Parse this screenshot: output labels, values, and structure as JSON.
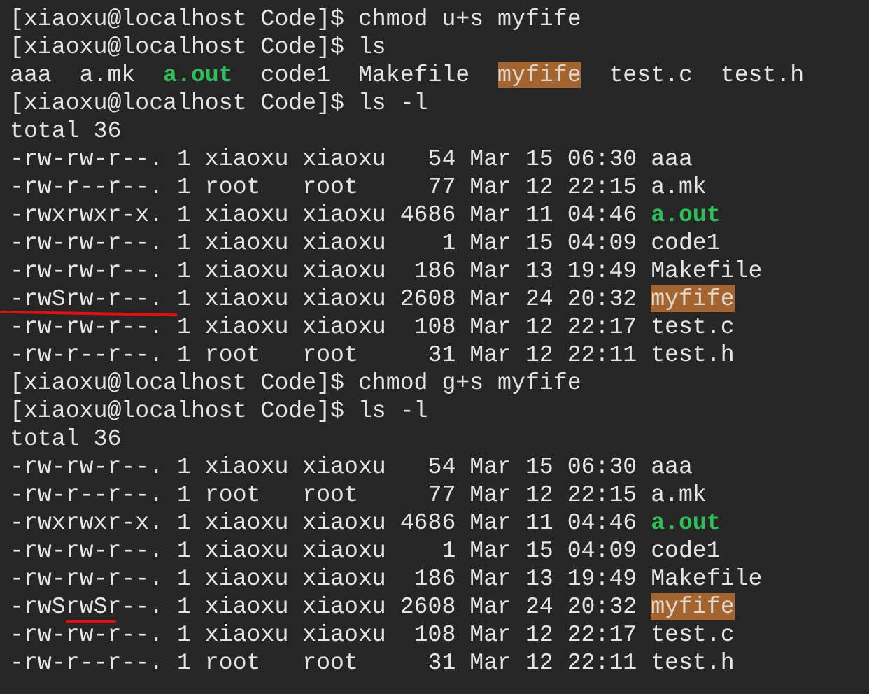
{
  "terminal": {
    "lines": [
      {
        "segments": [
          {
            "text": "[xiaoxu@localhost Code]$ chmod u+s myfife",
            "kind": "plain"
          }
        ]
      },
      {
        "segments": [
          {
            "text": "[xiaoxu@localhost Code]$ ls",
            "kind": "plain"
          }
        ]
      },
      {
        "segments": [
          {
            "text": "aaa  a.mk  ",
            "kind": "plain"
          },
          {
            "text": "a.out",
            "kind": "exec"
          },
          {
            "text": "  code1  Makefile  ",
            "kind": "plain"
          },
          {
            "text": "myfife",
            "kind": "setid"
          },
          {
            "text": "  test.c  test.h",
            "kind": "plain"
          }
        ]
      },
      {
        "segments": [
          {
            "text": "[xiaoxu@localhost Code]$ ls -l",
            "kind": "plain"
          }
        ]
      },
      {
        "segments": [
          {
            "text": "total 36",
            "kind": "plain"
          }
        ]
      },
      {
        "segments": [
          {
            "text": "-rw-rw-r--. 1 xiaoxu xiaoxu   54 Mar 15 06:30 ",
            "kind": "plain"
          },
          {
            "text": "aaa",
            "kind": "plain"
          }
        ]
      },
      {
        "segments": [
          {
            "text": "-rw-r--r--. 1 root   root     77 Mar 12 22:15 ",
            "kind": "plain"
          },
          {
            "text": "a.mk",
            "kind": "plain"
          }
        ]
      },
      {
        "segments": [
          {
            "text": "-rwxrwxr-x. 1 xiaoxu xiaoxu 4686 Mar 11 04:46 ",
            "kind": "plain"
          },
          {
            "text": "a.out",
            "kind": "exec"
          }
        ]
      },
      {
        "segments": [
          {
            "text": "-rw-rw-r--. 1 xiaoxu xiaoxu    1 Mar 15 04:09 ",
            "kind": "plain"
          },
          {
            "text": "code1",
            "kind": "plain"
          }
        ]
      },
      {
        "segments": [
          {
            "text": "-rw-rw-r--. 1 xiaoxu xiaoxu  186 Mar 13 19:49 ",
            "kind": "plain"
          },
          {
            "text": "Makefile",
            "kind": "plain"
          }
        ]
      },
      {
        "segments": [
          {
            "text": "-rwSrw-r--. 1 xiaoxu xiaoxu 2608 Mar 24 20:32 ",
            "kind": "plain"
          },
          {
            "text": "myfife",
            "kind": "setid"
          }
        ],
        "annotation": {
          "kind": "long-underline"
        }
      },
      {
        "segments": [
          {
            "text": "-rw-rw-r--. 1 xiaoxu xiaoxu  108 Mar 12 22:17 ",
            "kind": "plain"
          },
          {
            "text": "test.c",
            "kind": "plain"
          }
        ]
      },
      {
        "segments": [
          {
            "text": "-rw-r--r--. 1 root   root     31 Mar 12 22:11 ",
            "kind": "plain"
          },
          {
            "text": "test.h",
            "kind": "plain"
          }
        ]
      },
      {
        "segments": [
          {
            "text": "[xiaoxu@localhost Code]$ chmod g+s myfife",
            "kind": "plain"
          }
        ]
      },
      {
        "segments": [
          {
            "text": "[xiaoxu@localhost Code]$ ls -l",
            "kind": "plain"
          }
        ]
      },
      {
        "segments": [
          {
            "text": "total 36",
            "kind": "plain"
          }
        ]
      },
      {
        "segments": [
          {
            "text": "-rw-rw-r--. 1 xiaoxu xiaoxu   54 Mar 15 06:30 ",
            "kind": "plain"
          },
          {
            "text": "aaa",
            "kind": "plain"
          }
        ]
      },
      {
        "segments": [
          {
            "text": "-rw-r--r--. 1 root   root     77 Mar 12 22:15 ",
            "kind": "plain"
          },
          {
            "text": "a.mk",
            "kind": "plain"
          }
        ]
      },
      {
        "segments": [
          {
            "text": "-rwxrwxr-x. 1 xiaoxu xiaoxu 4686 Mar 11 04:46 ",
            "kind": "plain"
          },
          {
            "text": "a.out",
            "kind": "exec"
          }
        ]
      },
      {
        "segments": [
          {
            "text": "-rw-rw-r--. 1 xiaoxu xiaoxu    1 Mar 15 04:09 ",
            "kind": "plain"
          },
          {
            "text": "code1",
            "kind": "plain"
          }
        ]
      },
      {
        "segments": [
          {
            "text": "-rw-rw-r--. 1 xiaoxu xiaoxu  186 Mar 13 19:49 ",
            "kind": "plain"
          },
          {
            "text": "Makefile",
            "kind": "plain"
          }
        ]
      },
      {
        "segments": [
          {
            "text": "-rwSrwSr--. 1 xiaoxu xiaoxu 2608 Mar 24 20:32 ",
            "kind": "plain"
          },
          {
            "text": "myfife",
            "kind": "setid"
          }
        ],
        "annotation": {
          "kind": "short-underline"
        }
      },
      {
        "segments": [
          {
            "text": "-rw-rw-r--. 1 xiaoxu xiaoxu  108 Mar 12 22:17 ",
            "kind": "plain"
          },
          {
            "text": "test.c",
            "kind": "plain"
          }
        ]
      },
      {
        "segments": [
          {
            "text": "-rw-r--r--. 1 root   root     31 Mar 12 22:11 ",
            "kind": "plain"
          },
          {
            "text": "test.h",
            "kind": "plain"
          }
        ]
      }
    ]
  }
}
